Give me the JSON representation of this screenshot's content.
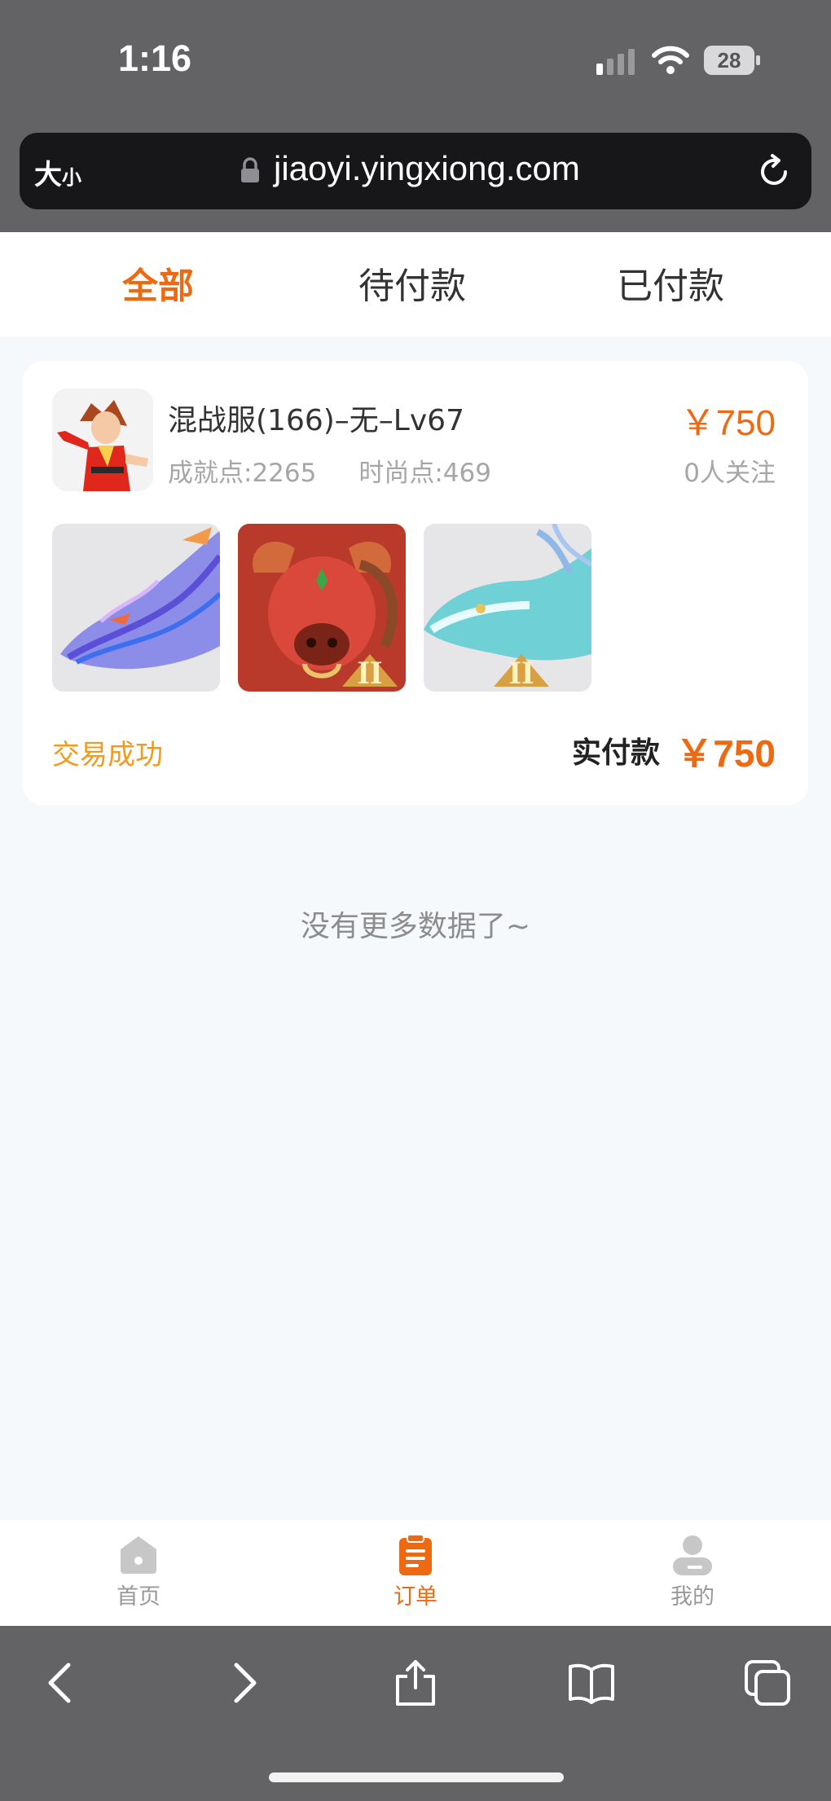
{
  "status_bar": {
    "time": "1:16",
    "battery": "28"
  },
  "browser": {
    "text_size_big": "大",
    "text_size_small": "小",
    "url": "jiaoyi.yingxiong.com"
  },
  "tabs": [
    {
      "label": "全部",
      "active": true
    },
    {
      "label": "待付款",
      "active": false
    },
    {
      "label": "已付款",
      "active": false
    }
  ],
  "order": {
    "title": "混战服(166)–无–Lv67",
    "achievement": "成就点:2265",
    "fashion": "时尚点:469",
    "price": "￥750",
    "followers": "0人关注",
    "status": "交易成功",
    "paid_label": "实付款",
    "paid_amount": "￥750",
    "thumbnails": [
      "purple-dragon-icon",
      "red-bull-demon-icon",
      "teal-dragon-icon"
    ]
  },
  "no_more_text": "没有更多数据了~",
  "app_nav": [
    {
      "label": "首页",
      "icon": "home-icon",
      "active": false
    },
    {
      "label": "订单",
      "icon": "orders-icon",
      "active": true
    },
    {
      "label": "我的",
      "icon": "profile-icon",
      "active": false
    }
  ],
  "colors": {
    "accent": "#ee6a12",
    "status_success": "#f19a1d",
    "browser_chrome": "#636366"
  }
}
